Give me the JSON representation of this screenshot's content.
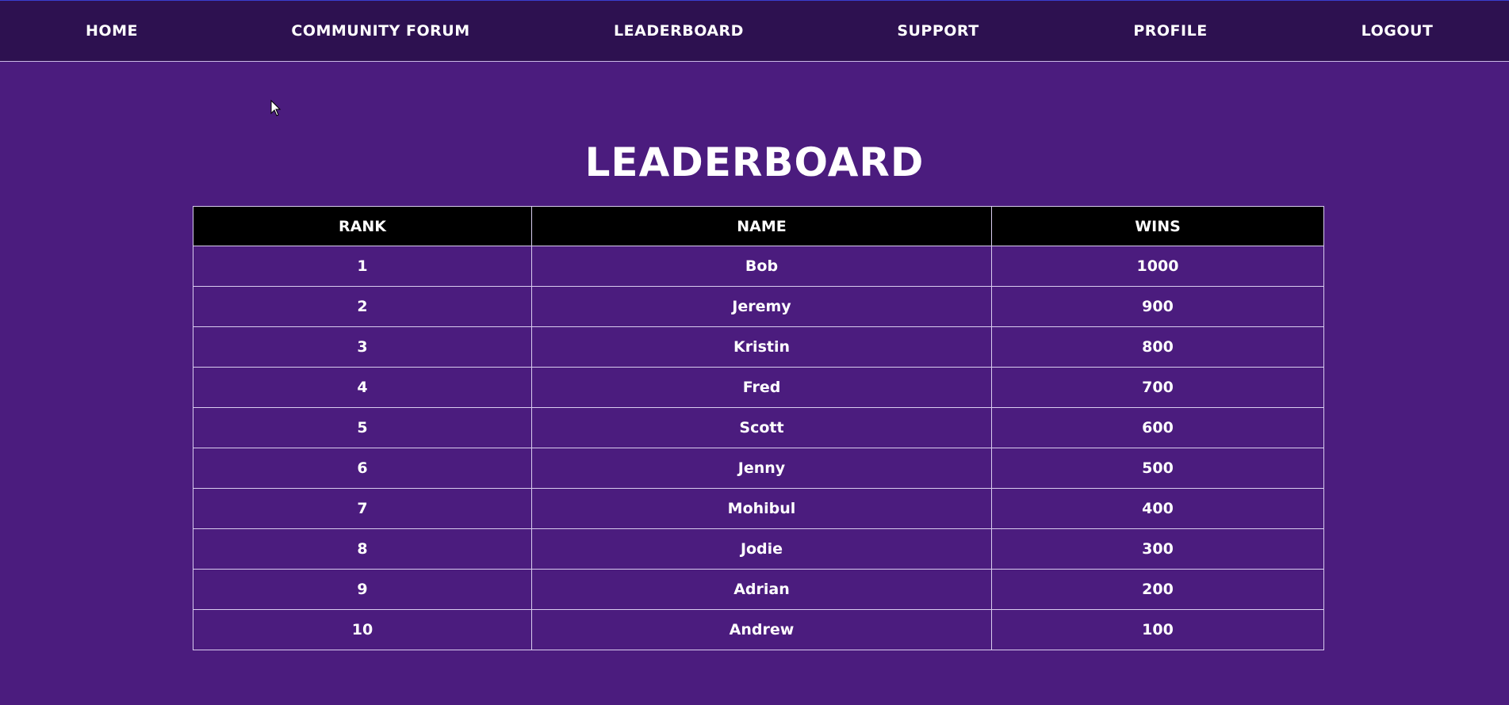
{
  "nav": {
    "items": [
      {
        "label": "HOME"
      },
      {
        "label": "COMMUNITY FORUM"
      },
      {
        "label": "LEADERBOARD"
      },
      {
        "label": "SUPPORT"
      },
      {
        "label": "PROFILE"
      },
      {
        "label": "LOGOUT"
      }
    ]
  },
  "page": {
    "title": "LEADERBOARD"
  },
  "table": {
    "headers": [
      "RANK",
      "NAME",
      "WINS"
    ],
    "rows": [
      {
        "rank": "1",
        "name": "Bob",
        "wins": "1000"
      },
      {
        "rank": "2",
        "name": "Jeremy",
        "wins": "900"
      },
      {
        "rank": "3",
        "name": "Kristin",
        "wins": "800"
      },
      {
        "rank": "4",
        "name": "Fred",
        "wins": "700"
      },
      {
        "rank": "5",
        "name": "Scott",
        "wins": "600"
      },
      {
        "rank": "6",
        "name": "Jenny",
        "wins": "500"
      },
      {
        "rank": "7",
        "name": "Mohibul",
        "wins": "400"
      },
      {
        "rank": "8",
        "name": "Jodie",
        "wins": "300"
      },
      {
        "rank": "9",
        "name": "Adrian",
        "wins": "200"
      },
      {
        "rank": "10",
        "name": "Andrew",
        "wins": "100"
      }
    ]
  },
  "colors": {
    "background": "#4b1c7e",
    "navbar": "#2d1150",
    "header_row": "#000000",
    "text": "#ffffff"
  }
}
